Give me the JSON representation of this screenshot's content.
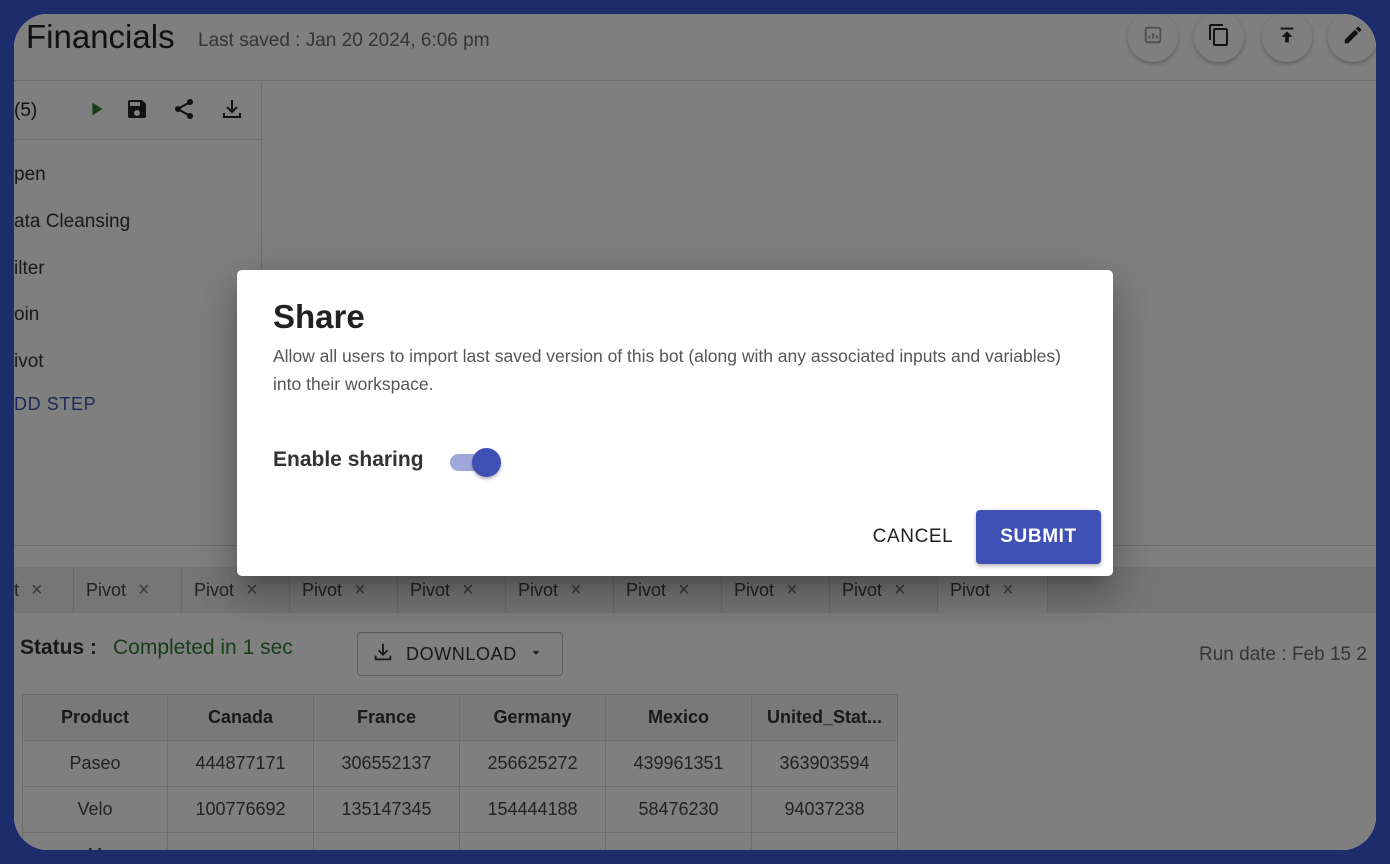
{
  "header": {
    "title": "Financials",
    "last_saved": "Last saved : Jan 20 2024, 6:06 pm",
    "action_icons": [
      "chart-icon",
      "copy-icon",
      "upload-icon",
      "edit-icon"
    ]
  },
  "left_panel": {
    "count": "(5)",
    "toolbar_icons": [
      "play-icon",
      "save-icon",
      "share-icon",
      "download-icon"
    ],
    "steps": [
      "pen",
      "ata Cleansing",
      "ilter",
      "oin",
      "ivot"
    ],
    "add_step": "DD STEP"
  },
  "tabs": [
    {
      "label": "t",
      "active": false
    },
    {
      "label": "Pivot",
      "active": false
    },
    {
      "label": "Pivot",
      "active": false
    },
    {
      "label": "Pivot",
      "active": false
    },
    {
      "label": "Pivot",
      "active": false
    },
    {
      "label": "Pivot",
      "active": false
    },
    {
      "label": "Pivot",
      "active": false
    },
    {
      "label": "Pivot",
      "active": false
    },
    {
      "label": "Pivot",
      "active": false
    },
    {
      "label": "Pivot",
      "active": true
    }
  ],
  "status": {
    "label": "Status :",
    "value": "Completed in 1 sec",
    "download_label": "DOWNLOAD",
    "run_date": "Run date : Feb 15 2"
  },
  "table": {
    "columns": [
      "Product",
      "Canada",
      "France",
      "Germany",
      "Mexico",
      "United_Stat..."
    ],
    "rows": [
      [
        "Paseo",
        "444877171",
        "306552137",
        "256625272",
        "439961351",
        "363903594"
      ],
      [
        "Velo",
        "100776692",
        "135147345",
        "154444188",
        "58476230",
        "94037238"
      ],
      [
        "M",
        "",
        "",
        "",
        "",
        ""
      ]
    ]
  },
  "dialog": {
    "title": "Share",
    "description": "Allow all users to import last saved version of this bot (along with any associated inputs and variables) into their workspace.",
    "toggle_label": "Enable sharing",
    "toggle_on": true,
    "cancel_label": "CANCEL",
    "submit_label": "SUBMIT"
  },
  "colors": {
    "primary": "#3f51b5",
    "success": "#2e7d32",
    "frame": "#1d2d6b"
  }
}
